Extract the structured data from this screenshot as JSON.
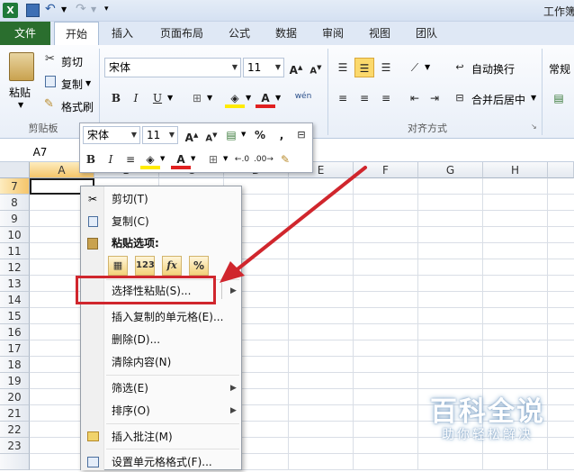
{
  "window": {
    "title": "工作簿"
  },
  "tabs": {
    "file": "文件",
    "home": "开始",
    "insert": "插入",
    "page_layout": "页面布局",
    "formulas": "公式",
    "data": "数据",
    "review": "审阅",
    "view": "视图",
    "team": "团队"
  },
  "ribbon": {
    "clipboard": {
      "paste": "粘贴",
      "cut": "剪切",
      "copy": "复制",
      "format_painter": "格式刷",
      "group_label": "剪贴板"
    },
    "font": {
      "name": "宋体",
      "size": "11",
      "bold": "B",
      "italic": "I",
      "underline": "U"
    },
    "alignment": {
      "wrap_text": "自动换行",
      "merge_center": "合并后居中",
      "group_label": "对齐方式"
    },
    "number": {
      "format": "常规"
    }
  },
  "formula_bar": {
    "name_box": "A7"
  },
  "mini_toolbar": {
    "font_name": "宋体",
    "font_size": "11",
    "percent": "%",
    "comma": ",",
    "bold": "B",
    "italic": "I"
  },
  "sheet": {
    "columns": [
      "A",
      "B",
      "C",
      "D",
      "E",
      "F",
      "G",
      "H"
    ],
    "rows": [
      "7",
      "8",
      "9",
      "10",
      "11",
      "12",
      "13",
      "14",
      "15",
      "16",
      "17",
      "18",
      "19",
      "20",
      "21",
      "22",
      "23"
    ]
  },
  "context_menu": {
    "cut": "剪切(T)",
    "copy": "复制(C)",
    "paste_options": "粘贴选项:",
    "paste_special": "选择性粘贴(S)...",
    "insert_copied": "插入复制的单元格(E)...",
    "delete": "删除(D)...",
    "clear_contents": "清除内容(N)",
    "filter": "筛选(E)",
    "sort": "排序(O)",
    "insert_comment": "插入批注(M)",
    "format_cells": "设置单元格格式(F)..."
  },
  "watermark": {
    "line1": "百科全说",
    "line2": "助你轻松解决"
  },
  "colors": {
    "file_tab": "#2a6e2e",
    "highlight": "#d0262d",
    "arrow": "#d0262d"
  }
}
